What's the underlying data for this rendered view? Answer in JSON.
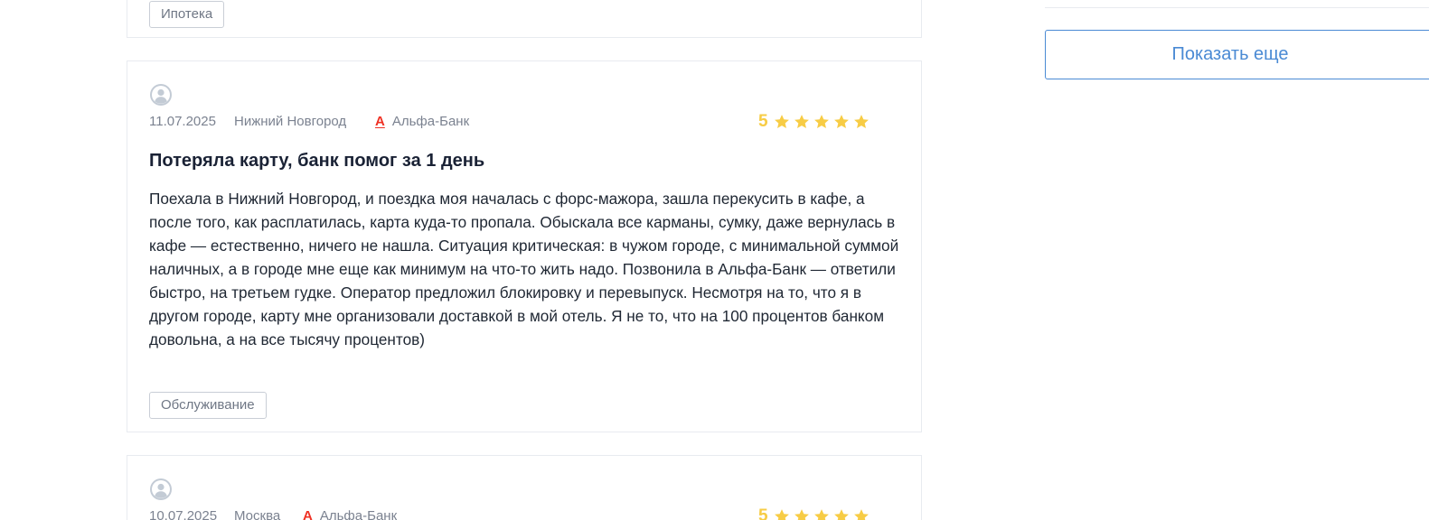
{
  "reviews": [
    {
      "tag": "Ипотека"
    },
    {
      "date": "11.07.2025",
      "city": "Нижний Новгород",
      "bank_logo": "А",
      "bank": "Альфа-Банк",
      "rating": "5",
      "rating_value": 5,
      "title": "Потеряла карту, банк помог за 1 день",
      "body": "Поехала в Нижний Новгород, и поездка моя началась с форс-мажора, зашла перекусить в кафе, а после того, как расплатилась, карта куда-то пропала. Обыскала все карманы, сумку, даже вернулась в кафе — естественно, ничего не нашла. Ситуация критическая: в чужом городе, с минимальной суммой наличных, а в городе мне еще как минимум на что-то жить надо. Позвонила в Альфа-Банк — ответили быстро, на третьем гудке. Оператор предложил блокировку и перевыпуск. Несмотря на то, что я в другом городе, карту мне организовали доставкой в мой отель. Я не то, что на 100 процентов банком довольна, а на все тысячу процентов)",
      "tag": "Обслуживание"
    },
    {
      "date": "10.07.2025",
      "city": "Москва",
      "bank_logo": "А",
      "bank": "Альфа-Банк",
      "rating": "5",
      "rating_value": 5
    }
  ],
  "sidebar": {
    "show_more_label": "Показать еще"
  },
  "colors": {
    "star": "#f7cc45",
    "accent": "#4a8ad4",
    "alfa": "#ef3124"
  },
  "icons": {
    "avatar": "user-avatar-icon",
    "star": "star-icon",
    "bank_logo": "alfa-bank-logo-icon"
  }
}
